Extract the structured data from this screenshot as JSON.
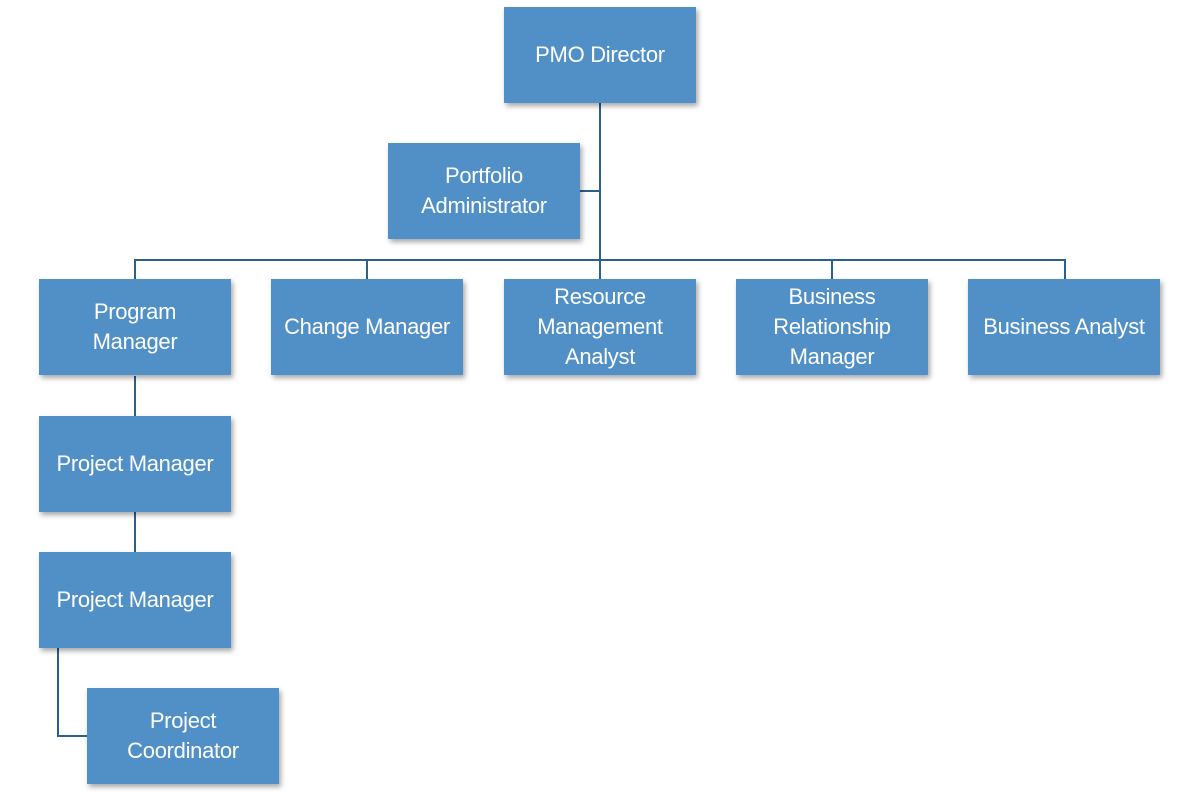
{
  "colors": {
    "box": "#5090C6",
    "connector": "#2B5F8E",
    "text": "#FFFFFF"
  },
  "nodes": {
    "pmo_director": "PMO Director",
    "portfolio_administrator": "Portfolio\nAdministrator",
    "program_manager": "Program\nManager",
    "change_manager": "Change Manager",
    "resource_management_analyst": "Resource\nManagement\nAnalyst",
    "business_relationship_manager": "Business\nRelationship\nManager",
    "business_analyst": "Business Analyst",
    "project_manager_1": "Project Manager",
    "project_manager_2": "Project Manager",
    "project_coordinator": "Project\nCoordinator"
  }
}
